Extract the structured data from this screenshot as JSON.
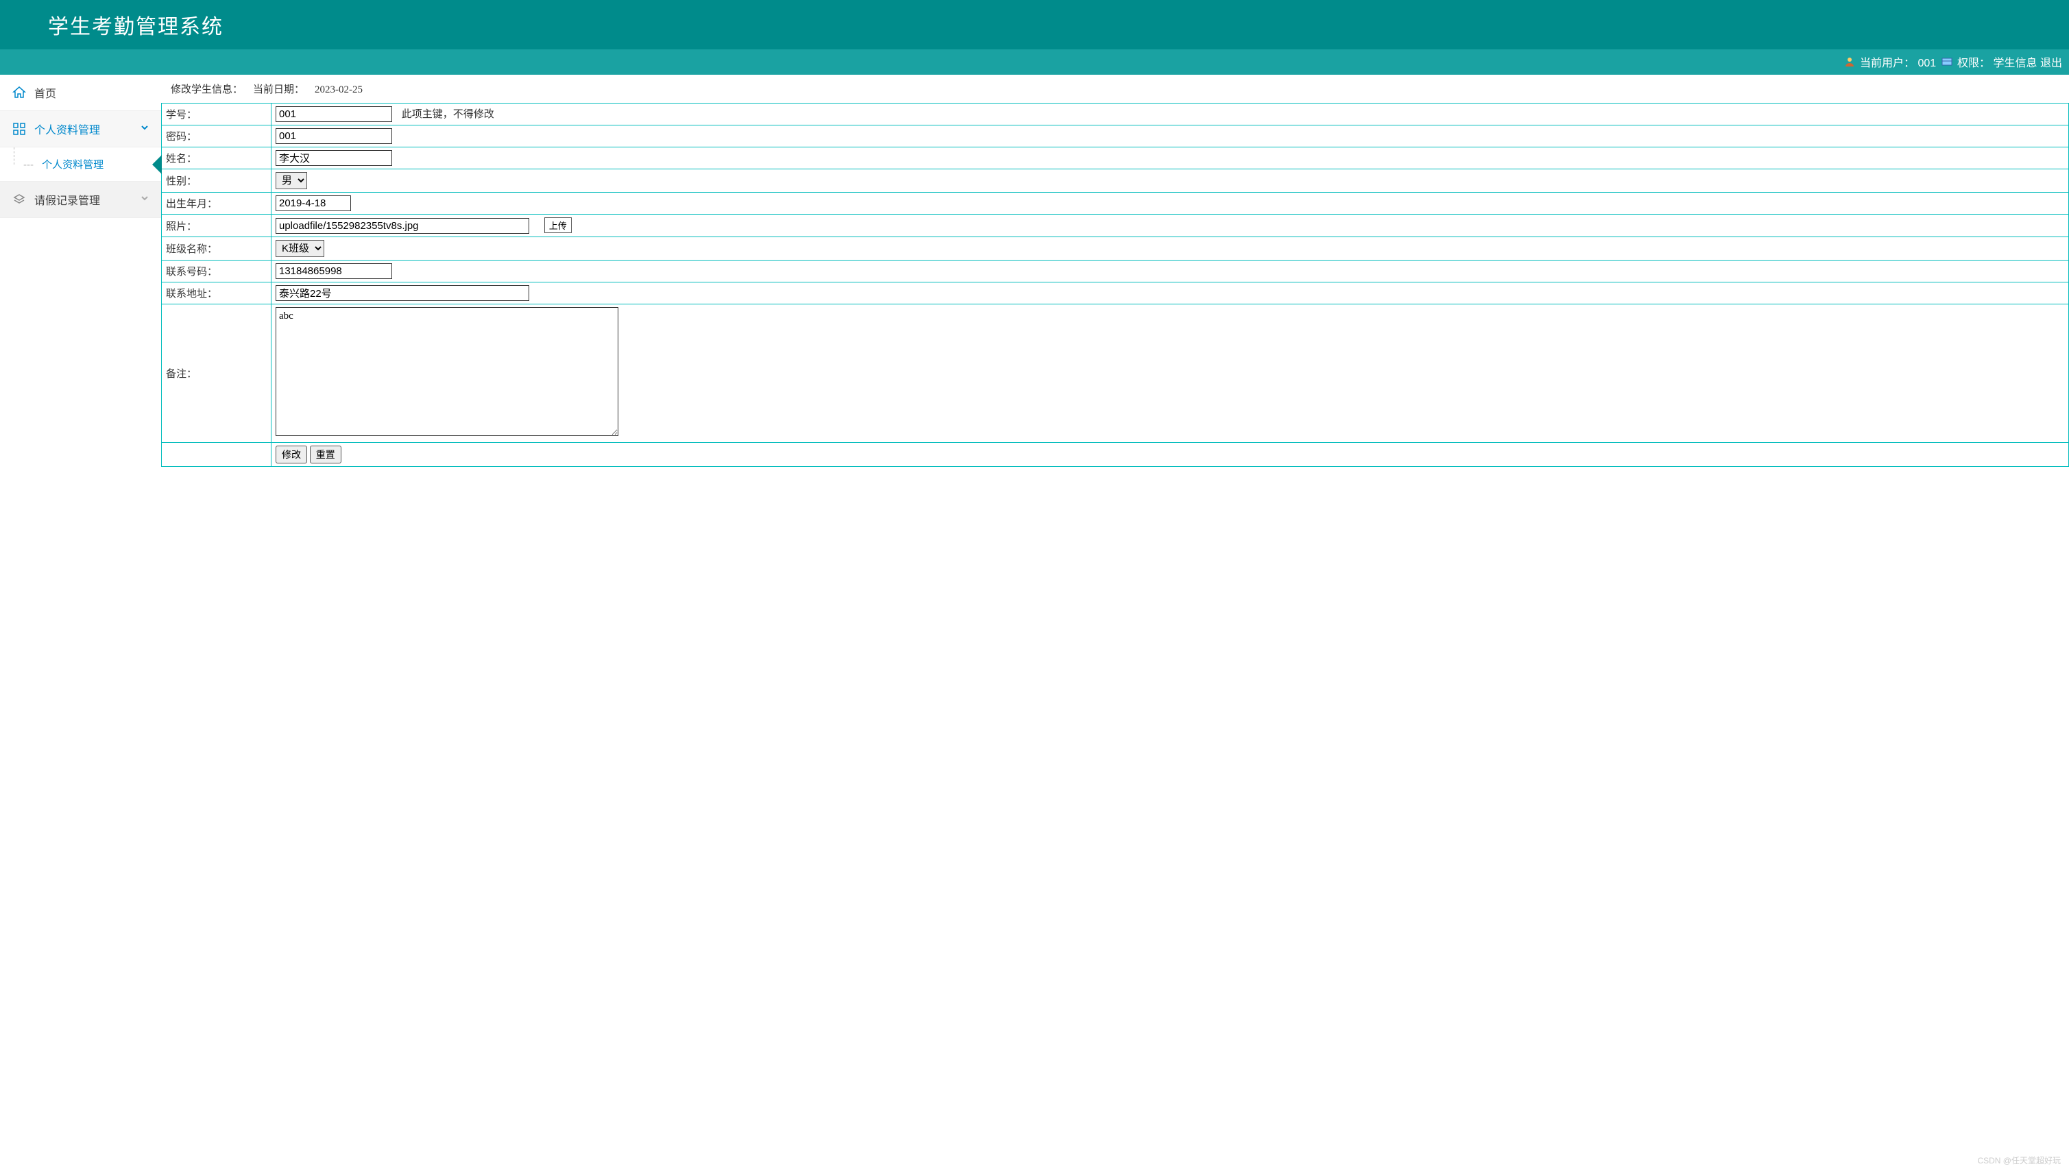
{
  "header": {
    "title": "学生考勤管理系统"
  },
  "statusbar": {
    "current_user_label": "当前用户：",
    "current_user": "001",
    "role_label": "权限：",
    "role": "学生信息",
    "logout": "退出"
  },
  "sidebar": {
    "items": [
      {
        "label": "首页"
      },
      {
        "label": "个人资料管理"
      },
      {
        "label": "请假记录管理"
      }
    ],
    "sub_item": "个人资料管理"
  },
  "page": {
    "title_prefix": "修改学生信息：",
    "date_label": "当前日期：",
    "date_value": "2023-02-25"
  },
  "form": {
    "student_id": {
      "label": "学号：",
      "value": "001",
      "hint": "此项主键，不得修改"
    },
    "password": {
      "label": "密码：",
      "value": "001"
    },
    "name": {
      "label": "姓名：",
      "value": "李大汉"
    },
    "gender": {
      "label": "性别：",
      "value": "男"
    },
    "birth": {
      "label": "出生年月：",
      "value": "2019-4-18"
    },
    "photo": {
      "label": "照片：",
      "value": "uploadfile/1552982355tv8s.jpg",
      "upload_btn": "上传"
    },
    "class_name": {
      "label": "班级名称：",
      "value": "K班级"
    },
    "phone": {
      "label": "联系号码：",
      "value": "13184865998"
    },
    "address": {
      "label": "联系地址：",
      "value": "泰兴路22号"
    },
    "remark": {
      "label": "备注：",
      "value": "abc"
    },
    "buttons": {
      "save": "修改",
      "reset": "重置"
    }
  },
  "watermark": "CSDN @任天堂超好玩"
}
